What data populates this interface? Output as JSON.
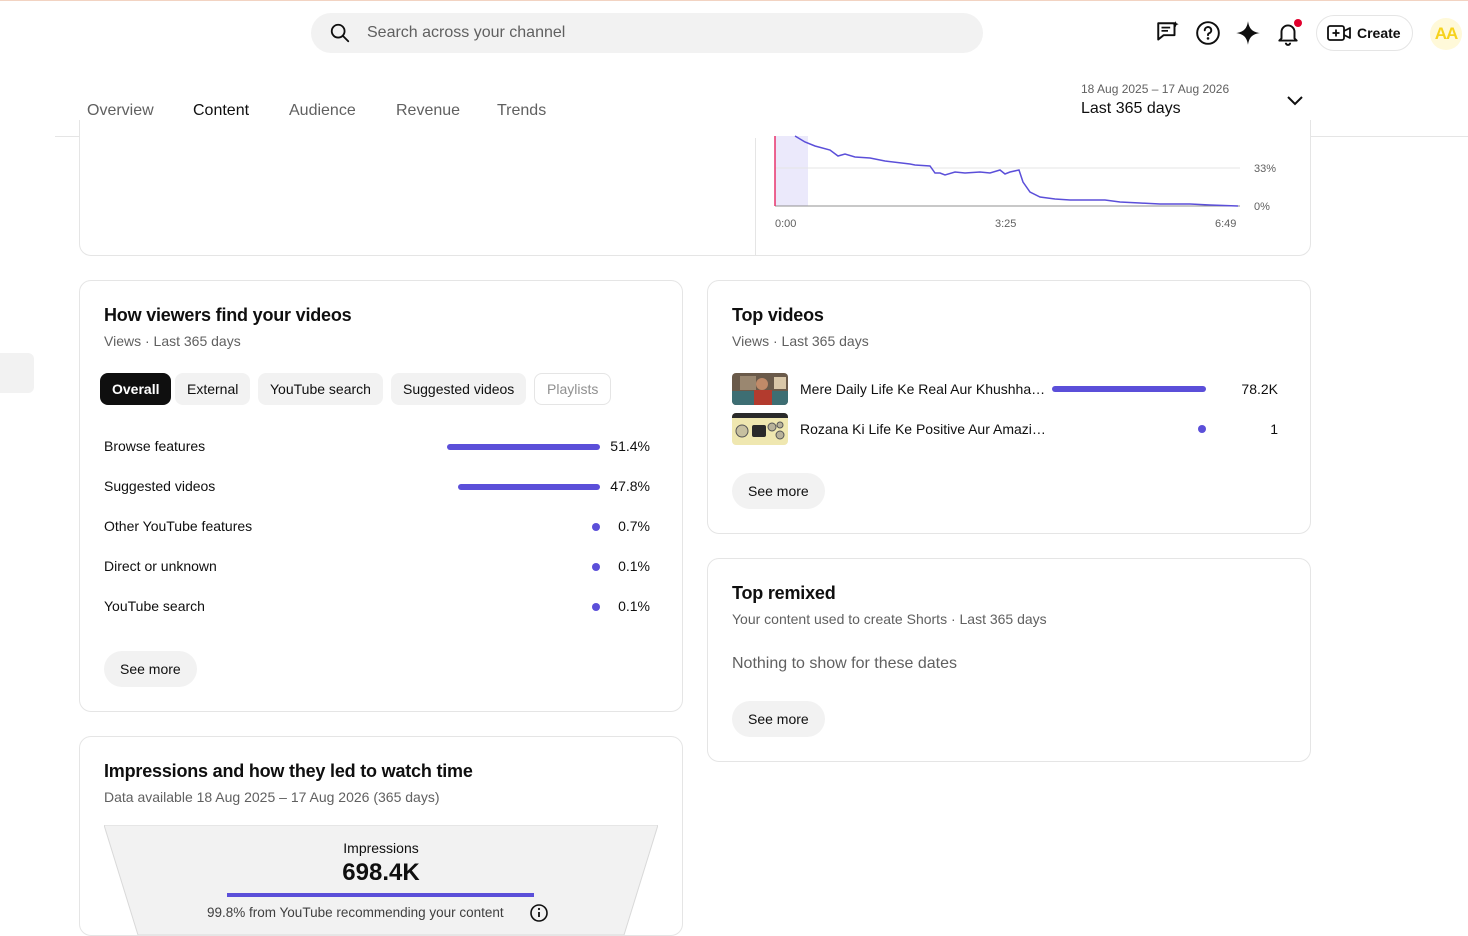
{
  "header": {
    "search_placeholder": "Search across your channel",
    "create_label": "Create",
    "avatar_initials": "AA",
    "icons": [
      "feedback-icon",
      "help-icon",
      "sparkle-icon",
      "notifications-icon",
      "create-video-icon"
    ]
  },
  "tabs": [
    {
      "label": "Overview"
    },
    {
      "label": "Content"
    },
    {
      "label": "Audience"
    },
    {
      "label": "Revenue"
    },
    {
      "label": "Trends"
    }
  ],
  "active_tab": "Content",
  "date_range": {
    "range": "18 Aug 2025 – 17 Aug 2026",
    "label": "Last 365 days"
  },
  "retention_chart": {
    "y_ticks": [
      "33%",
      "0%"
    ],
    "x_ticks": [
      "0:00",
      "3:25",
      "6:49"
    ]
  },
  "traffic_sources": {
    "title": "How viewers find your videos",
    "subtitle": "Views · Last 365 days",
    "chips": [
      "Overall",
      "External",
      "YouTube search",
      "Suggested videos",
      "Playlists"
    ],
    "rows": [
      {
        "label": "Browse features",
        "value": "51.4%",
        "pct": 51.4
      },
      {
        "label": "Suggested videos",
        "value": "47.8%",
        "pct": 47.8
      },
      {
        "label": "Other YouTube features",
        "value": "0.7%",
        "pct": 0.7
      },
      {
        "label": "Direct or unknown",
        "value": "0.1%",
        "pct": 0.1
      },
      {
        "label": "YouTube search",
        "value": "0.1%",
        "pct": 0.1
      }
    ],
    "see_more": "See more"
  },
  "top_videos": {
    "title": "Top videos",
    "subtitle": "Views · Last 365 days",
    "rows": [
      {
        "title": "Mere Daily Life Ke Real Aur Khushhaal Pal…",
        "value": "78.2K",
        "views": 78200
      },
      {
        "title": "Rozana Ki Life Ke Positive Aur Amazing Pal…",
        "value": "1",
        "views": 1
      }
    ],
    "see_more": "See more"
  },
  "top_remixed": {
    "title": "Top remixed",
    "subtitle": "Your content used to create Shorts · Last 365 days",
    "empty": "Nothing to show for these dates",
    "see_more": "See more"
  },
  "impressions": {
    "title": "Impressions and how they led to watch time",
    "subtitle": "Data available 18 Aug 2025 – 17 Aug 2026 (365 days)",
    "label": "Impressions",
    "value": "698.4K",
    "note": "99.8% from YouTube recommending your content",
    "recommended_pct": 99.8
  },
  "colors": {
    "accent": "#5b4fd9",
    "text": "#0f0f0f",
    "secondary": "#606060"
  }
}
